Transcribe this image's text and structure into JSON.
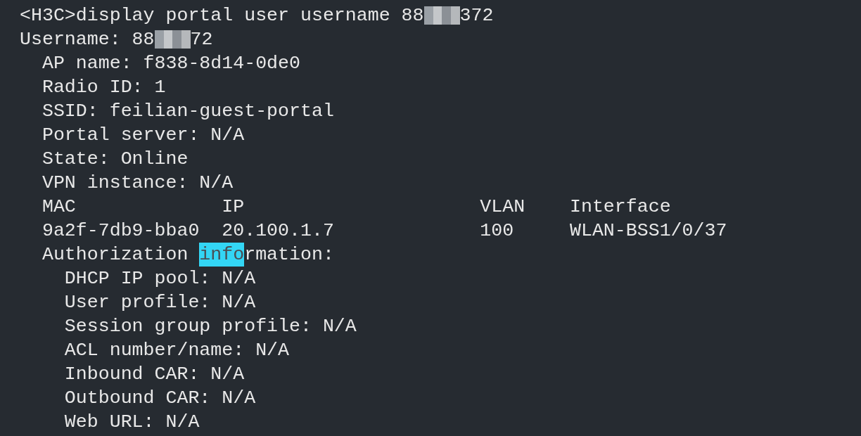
{
  "terminal": {
    "lines": [
      {
        "segments": [
          {
            "kind": "text",
            "text": "<H3C>display portal user username 88"
          },
          {
            "kind": "redacted"
          },
          {
            "kind": "text",
            "text": "372"
          }
        ]
      },
      {
        "segments": [
          {
            "kind": "text",
            "text": "Username: 88"
          },
          {
            "kind": "redacted"
          },
          {
            "kind": "text",
            "text": "72"
          }
        ]
      },
      {
        "segments": [
          {
            "kind": "text",
            "text": "  AP name: f838-8d14-0de0"
          }
        ]
      },
      {
        "segments": [
          {
            "kind": "text",
            "text": "  Radio ID: 1"
          }
        ]
      },
      {
        "segments": [
          {
            "kind": "text",
            "text": "  SSID: feilian-guest-portal"
          }
        ]
      },
      {
        "segments": [
          {
            "kind": "text",
            "text": "  Portal server: N/A"
          }
        ]
      },
      {
        "segments": [
          {
            "kind": "text",
            "text": "  State: Online"
          }
        ]
      },
      {
        "segments": [
          {
            "kind": "text",
            "text": "  VPN instance: N/A"
          }
        ]
      },
      {
        "segments": [
          {
            "kind": "text",
            "text": "  MAC             IP                     VLAN    Interface"
          }
        ]
      },
      {
        "segments": [
          {
            "kind": "text",
            "text": "  9a2f-7db9-bba0  20.100.1.7             100     WLAN-BSS1/0/37"
          }
        ]
      },
      {
        "segments": [
          {
            "kind": "text",
            "text": "  Authorization "
          },
          {
            "kind": "highlight",
            "text": "info"
          },
          {
            "kind": "text",
            "text": "rmation:"
          }
        ]
      },
      {
        "segments": [
          {
            "kind": "text",
            "text": "    DHCP IP pool: N/A"
          }
        ]
      },
      {
        "segments": [
          {
            "kind": "text",
            "text": "    User profile: N/A"
          }
        ]
      },
      {
        "segments": [
          {
            "kind": "text",
            "text": "    Session group profile: N/A"
          }
        ]
      },
      {
        "segments": [
          {
            "kind": "text",
            "text": "    ACL number/name: N/A"
          }
        ]
      },
      {
        "segments": [
          {
            "kind": "text",
            "text": "    Inbound CAR: N/A"
          }
        ]
      },
      {
        "segments": [
          {
            "kind": "text",
            "text": "    Outbound CAR: N/A"
          }
        ]
      },
      {
        "segments": [
          {
            "kind": "text",
            "text": "    Web URL: N/A"
          }
        ]
      }
    ]
  }
}
